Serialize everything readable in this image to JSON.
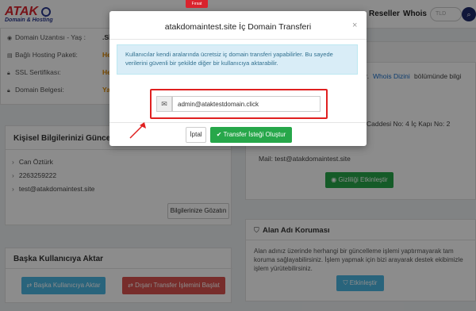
{
  "nav": {
    "brand": "ATAK",
    "brand_sub": "Domain & Hosting",
    "links": [
      "Reseller",
      "Whois"
    ],
    "search_placeholder": "TLD",
    "search_icon": "search-icon"
  },
  "domain_info": {
    "rows": [
      {
        "label": "Domain Uzantısı - Yaş :",
        "value": ".SİT",
        "icon": "globe-icon"
      },
      {
        "label": "Bağlı Hosting Paketi:",
        "value": "Hen",
        "icon": "server-icon"
      },
      {
        "label": "SSL Sertifikası:",
        "value": "Hen",
        "icon": "lock-icon"
      },
      {
        "label": "Domain Belgesi:",
        "value": "Yak",
        "icon": "lock-icon"
      }
    ]
  },
  "whois_panel": {
    "text1": "ır.",
    "link": "Whois Dizini",
    "text2": "bölümünde bilgi",
    "text3": "ı",
    "address": "Caddesi No: 4 İç Kapı No: 2",
    "mail": "Mail: test@atakdomaintest.site",
    "privacy_button": "Gizliliği Etkinleştir"
  },
  "personal": {
    "title": "Kişisel Bilgilerinizi Güncelleyin",
    "items": [
      "Can Öztürk",
      "2263259222",
      "test@atakdomaintest.site"
    ],
    "view_button": "Bilgilerinize Gözatın"
  },
  "protection": {
    "title": "Alan Adı Koruması",
    "text": "Alan adınız üzerinde herhangi bir güncelleme işlemi yaptırmayarak tam koruma sağlayabilirsiniz. İşlem yapmak için bizi arayarak destek ekibimizle işlem yürütebilirsiniz.",
    "button": "Etkinleştir"
  },
  "transfer": {
    "title": "Başka Kullanıcıya Aktar",
    "user_button": "Başka Kullanıcıya Aktar",
    "external_button": "Dışarı Transfer İşlemini Başlat"
  },
  "modal": {
    "title": "atakdomaintest.site İç Domain Transferi",
    "tab": "Fırsat",
    "alert": "Kullanıcılar kendi aralarında ücretsiz iç domain transferi yapabilirler. Bu sayede verilerini güvenli bir şekilde diğer bir kullanıcıya aktarabilir.",
    "email_value": "admin@ataktestdomain.click",
    "cancel_button": "İptal",
    "submit_button": "Transfer İsteği Oluştur"
  }
}
